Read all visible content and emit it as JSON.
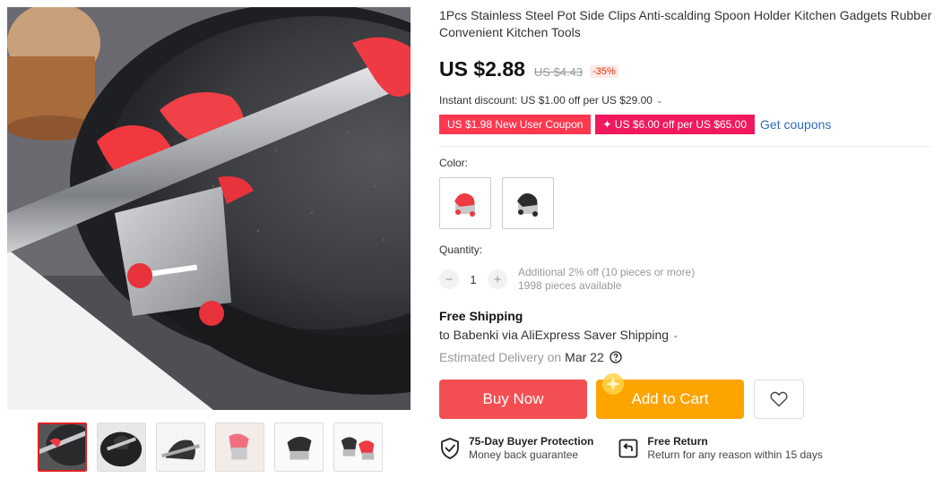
{
  "product": {
    "title": "1Pcs Stainless Steel Pot Side Clips Anti-scalding Spoon Holder Kitchen Gadgets Rubber Convenient Kitchen Tools",
    "price": "US $2.88",
    "original_price": "US $4.43",
    "discount": "-35%"
  },
  "promo": {
    "instant_discount": "Instant discount: US $1.00 off per US $29.00",
    "coupon_new_user": "US $1.98 New User Coupon",
    "coupon_store": "✦ US $6.00 off per US $65.00",
    "get_coupons": "Get coupons"
  },
  "options": {
    "color_label": "Color:",
    "colors": [
      "red-clip",
      "black-clip"
    ],
    "quantity_label": "Quantity:",
    "quantity_value": "1",
    "quantity_note": "Additional 2% off (10 pieces or more)",
    "available": "1998 pieces available"
  },
  "shipping": {
    "title": "Free Shipping",
    "route": "to Babenki via AliExpress Saver Shipping",
    "estimated_label": "Estimated Delivery on",
    "date": "Mar 22"
  },
  "actions": {
    "buy_now": "Buy Now",
    "add_to_cart": "Add to Cart"
  },
  "guarantees": [
    {
      "title": "75-Day Buyer Protection",
      "subtitle": "Money back guarantee",
      "icon": "shield-check-icon"
    },
    {
      "title": "Free Return",
      "subtitle": "Return for any reason within 15 days",
      "icon": "return-box-icon"
    }
  ],
  "gallery": {
    "thumbnails": [
      "red-clip-on-pan",
      "black-clip-on-pot",
      "black-clip-detail",
      "red-clip-hand",
      "black-clip-side",
      "clip-set"
    ],
    "active_index": 0
  },
  "colors": {
    "accent_red": "#f34f52",
    "accent_orange": "#fea400",
    "coupon_red": "#fd384f",
    "coupon_pink": "#f1195e",
    "link_blue": "#2e6db4"
  }
}
